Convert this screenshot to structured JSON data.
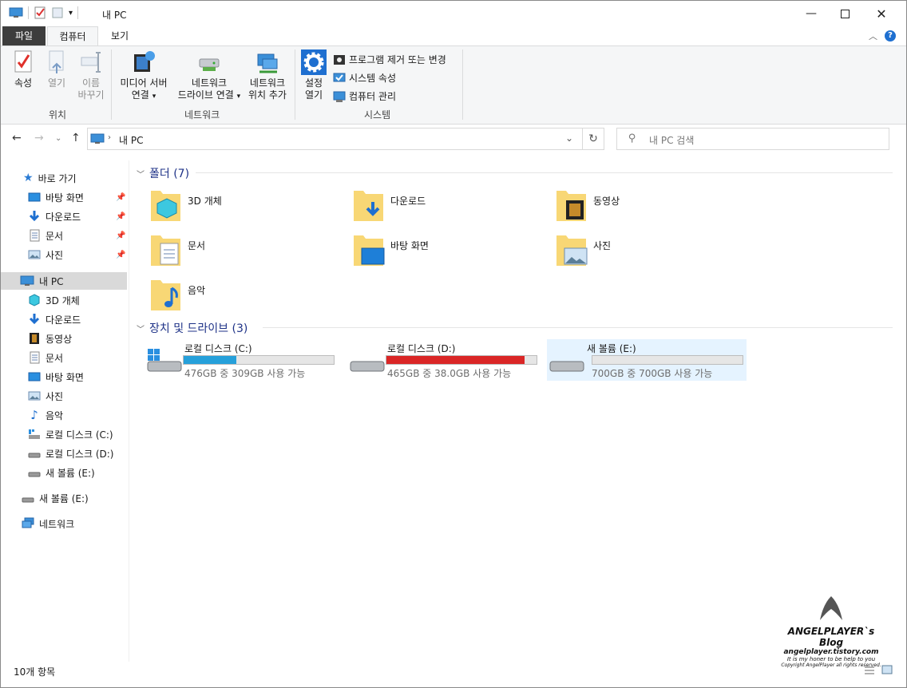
{
  "window": {
    "title": "내 PC"
  },
  "ribbon": {
    "tabs": [
      "파일",
      "컴퓨터",
      "보기"
    ],
    "location_group": {
      "label": "위치",
      "properties": "속성",
      "open": "열기",
      "rename_1": "이름",
      "rename_2": "바꾸기"
    },
    "network_group": {
      "label": "네트워크",
      "media_1": "미디어 서버",
      "media_2": "연결",
      "map_drive_1": "네트워크",
      "map_drive_2": "드라이브 연결",
      "add_location_1": "네트워크",
      "add_location_2": "위치 추가"
    },
    "system_group": {
      "label": "시스템",
      "settings_1": "설정",
      "settings_2": "열기",
      "uninstall": "프로그램 제거 또는 변경",
      "system_properties": "시스템 속성",
      "manage": "컴퓨터 관리"
    }
  },
  "address": {
    "path": "내 PC",
    "search_placeholder": "내 PC 검색"
  },
  "navpane": {
    "quick_access": "바로 가기",
    "quick_items": [
      "바탕 화면",
      "다운로드",
      "문서",
      "사진"
    ],
    "this_pc": "내 PC",
    "pc_items": [
      "3D 개체",
      "다운로드",
      "동영상",
      "문서",
      "바탕 화면",
      "사진",
      "음악",
      "로컬 디스크 (C:)",
      "로컬 디스크 (D:)",
      "새 볼륨 (E:)"
    ],
    "new_volume": "새 볼륨 (E:)",
    "network": "네트워크"
  },
  "content": {
    "folders_header": "폴더 (7)",
    "folders": [
      "3D 개체",
      "다운로드",
      "동영상",
      "문서",
      "바탕 화면",
      "사진",
      "음악"
    ],
    "drives_header": "장치 및 드라이브 (3)",
    "drives": [
      {
        "name": "로컬 디스크 (C:)",
        "free": "476GB 중 309GB 사용 가능",
        "used_fraction": 0.35,
        "color": "#26a0da"
      },
      {
        "name": "로컬 디스크 (D:)",
        "free": "465GB 중 38.0GB 사용 가능",
        "used_fraction": 0.92,
        "color": "#da2626"
      },
      {
        "name": "새 볼륨 (E:)",
        "free": "700GB 중 700GB 사용 가능",
        "used_fraction": 0.0,
        "color": "#26a0da"
      }
    ]
  },
  "status": {
    "count": "10개 항목"
  },
  "watermark": {
    "title": "ANGELPLAYER`s Blog",
    "url": "angelplayer.tistory.com",
    "tagline": "It is my honer to be help to you",
    "copyright": "Copyright AngelPlayer all rights reserved."
  }
}
